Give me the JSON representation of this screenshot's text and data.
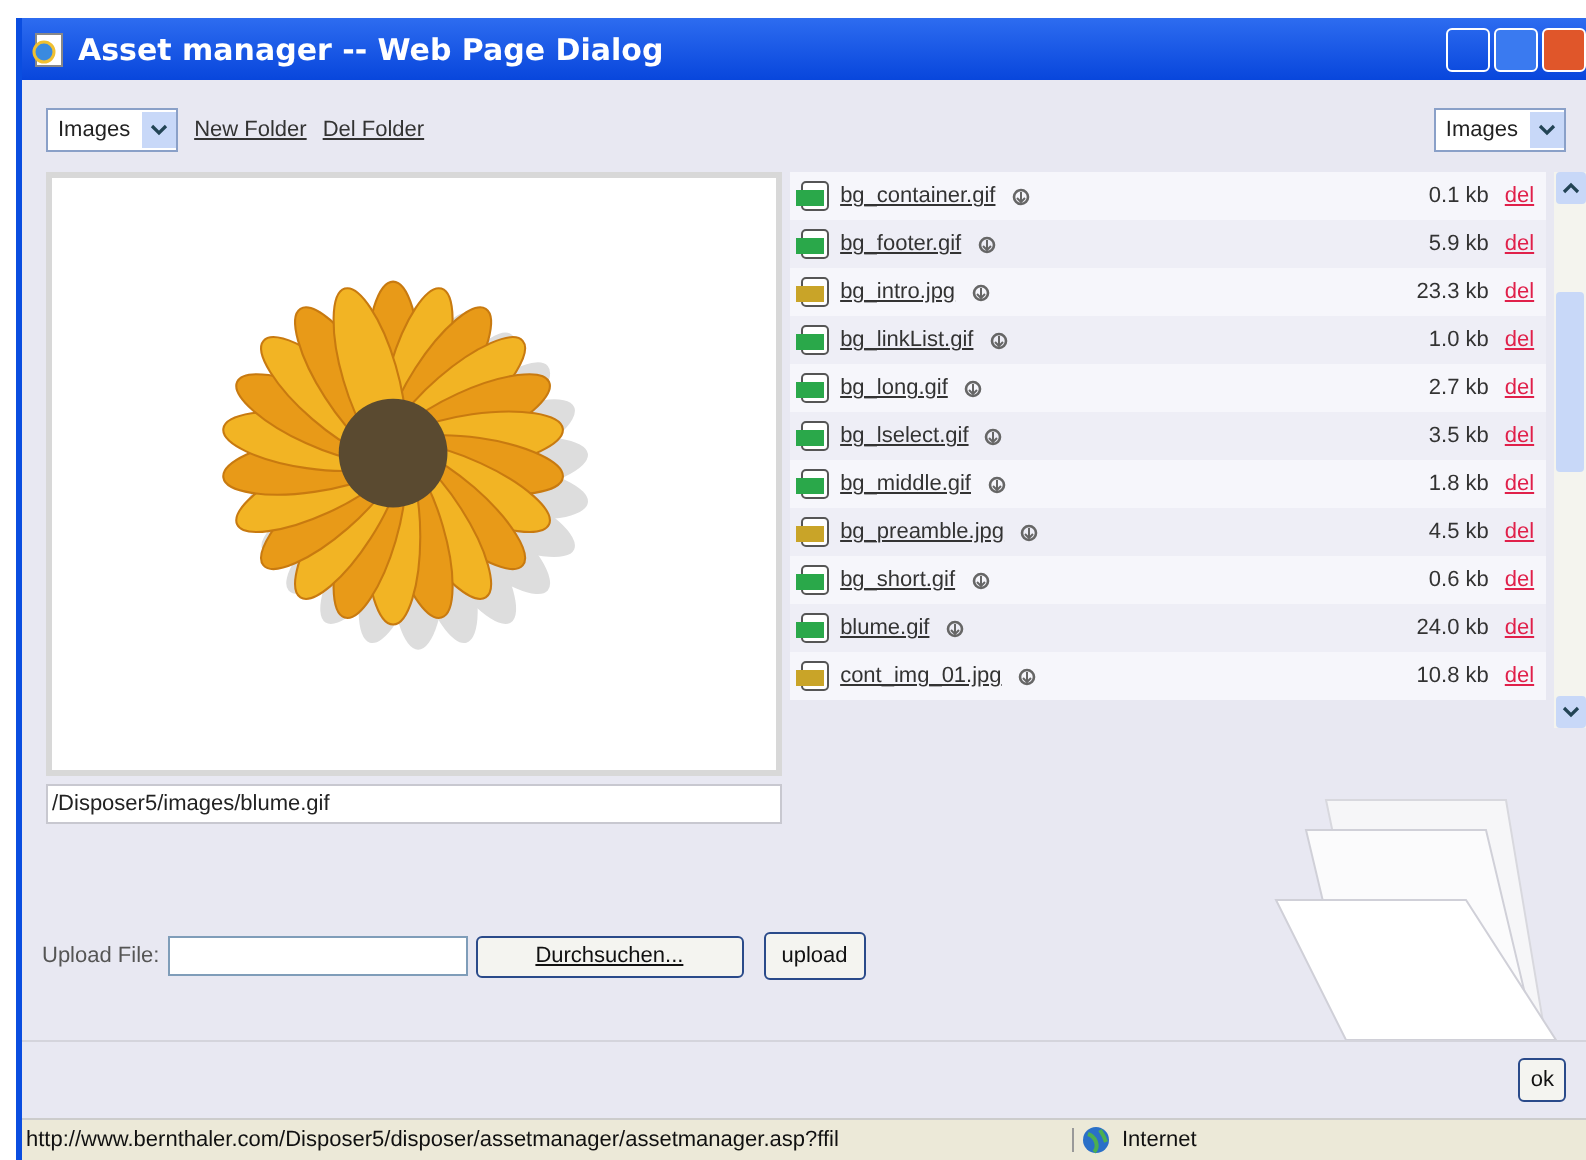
{
  "window": {
    "title": "Asset manager -- Web Page Dialog"
  },
  "toolbar": {
    "folder_select": "Images",
    "links": [
      "New Folder",
      "Del Folder"
    ],
    "view_select": "Images"
  },
  "preview": {
    "path": "/Disposer5/images/blume.gif"
  },
  "files": [
    {
      "name": "bg_container.gif",
      "kind": "gif",
      "size": "0.1 kb",
      "action": "del"
    },
    {
      "name": "bg_footer.gif",
      "kind": "gif",
      "size": "5.9 kb",
      "action": "del"
    },
    {
      "name": "bg_intro.jpg",
      "kind": "jpg",
      "size": "23.3 kb",
      "action": "del"
    },
    {
      "name": "bg_linkList.gif",
      "kind": "gif",
      "size": "1.0 kb",
      "action": "del"
    },
    {
      "name": "bg_long.gif",
      "kind": "gif",
      "size": "2.7 kb",
      "action": "del"
    },
    {
      "name": "bg_lselect.gif",
      "kind": "gif",
      "size": "3.5 kb",
      "action": "del"
    },
    {
      "name": "bg_middle.gif",
      "kind": "gif",
      "size": "1.8 kb",
      "action": "del"
    },
    {
      "name": "bg_preamble.jpg",
      "kind": "jpg",
      "size": "4.5 kb",
      "action": "del"
    },
    {
      "name": "bg_short.gif",
      "kind": "gif",
      "size": "0.6 kb",
      "action": "del"
    },
    {
      "name": "blume.gif",
      "kind": "gif",
      "size": "24.0 kb",
      "action": "del"
    },
    {
      "name": "cont_img_01.jpg",
      "kind": "jpg",
      "size": "10.8 kb",
      "action": "del"
    }
  ],
  "upload": {
    "label": "Upload File:",
    "browse_button": "Durchsuchen...",
    "upload_button": "upload"
  },
  "ok_button": "ok",
  "status_bar": {
    "url": "http://www.bernthaler.com/Disposer5/disposer/assetmanager/assetmanager.asp?ffil",
    "zone": "Internet"
  }
}
